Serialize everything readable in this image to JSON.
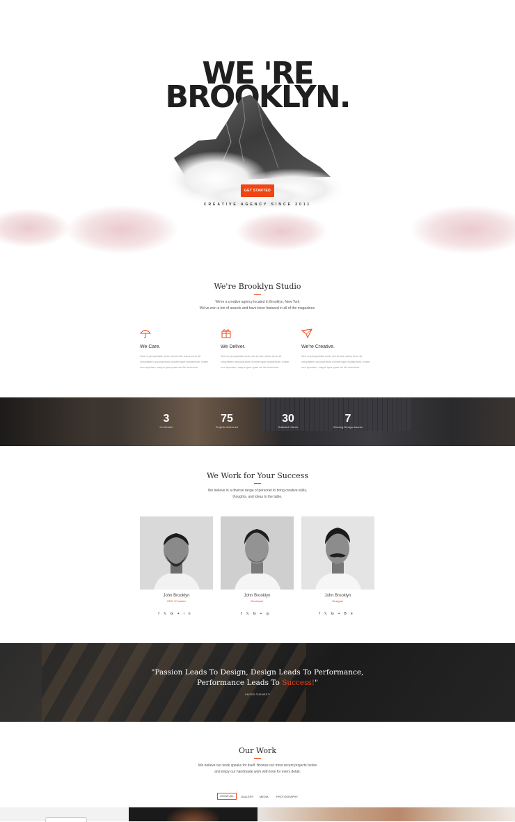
{
  "hero": {
    "title_line1": "WE 'RE",
    "title_line2": "BROOKLYN.",
    "cta_label": "GET STARTED",
    "tagline": "CREATIVE AGENCY SINCE 2011"
  },
  "studio": {
    "title": "We're Brooklyn Studio",
    "intro_line1": "We're a creative agency located in Brooklyn, New York",
    "intro_line2": "We've won a ton of awards and have been featured in all of the magazines.",
    "features": [
      {
        "icon": "umbrella-icon",
        "title": "We Care.",
        "text": "Sed ut perspiciatis unde omnis iste natus error sit voluptatem accusantium doloremque laudantium, totam rem aperiam, eaque ipsa quae ab illo inventore."
      },
      {
        "icon": "gift-box-icon",
        "title": "We Deliver.",
        "text": "Sed ut perspiciatis unde omnis iste natus error sit voluptatem accusantium doloremque laudantium, totam rem aperiam, eaque ipsa quae ab illo inventore."
      },
      {
        "icon": "paper-plane-icon",
        "title": "We're Creative.",
        "text": "Sed ut perspiciatis unde omnis iste natus error sit voluptatem accusantium doloremque laudantium, totam rem aperiam, eaque ipsa quae ab illo inventore."
      }
    ]
  },
  "stats": [
    {
      "value": "3",
      "label": "Co-Worker"
    },
    {
      "value": "75",
      "label": "Projects Delivered"
    },
    {
      "value": "30",
      "label": "Satisfied Clients"
    },
    {
      "value": "7",
      "label": "Winning Design Awards"
    }
  ],
  "team": {
    "title": "We Work for Your Success",
    "intro_line1": "We believe in a diverse range of personel to bring creative skills,",
    "intro_line2": "thoughts, and ideas to the table.",
    "members": [
      {
        "name": "John Brooklyn",
        "role": "CEO / Founder",
        "socials": [
          "facebook-icon",
          "twitter-icon",
          "google-plus-icon",
          "linkedin-icon"
        ]
      },
      {
        "name": "John Brooklyn",
        "role": "Developer",
        "socials": [
          "facebook-icon",
          "twitter-icon",
          "google-plus-icon",
          "github-icon"
        ]
      },
      {
        "name": "John Brooklyn",
        "role": "Designer",
        "socials": [
          "facebook-icon",
          "twitter-icon",
          "google-plus-icon",
          "behance-icon"
        ]
      }
    ]
  },
  "quote": {
    "line1": "\"Passion Leads To Design, Design Leads To Performance,",
    "line2_prefix": "Performance Leads To ",
    "line2_highlight": "Success!",
    "line2_suffix": "\"",
    "author": "UNITED THEMES™"
  },
  "work": {
    "title": "Our Work",
    "intro_line1": "We believe our work speaks for itself. Browse our most recent projects below",
    "intro_line2": "and enjoy our handmade work with love for every detail.",
    "filters": [
      "SHOW ALL",
      "GALLERY",
      "MEDIA",
      "PHOTOGRAPHY"
    ]
  },
  "colors": {
    "accent": "#f04412",
    "dark": "#1f1f1f"
  }
}
